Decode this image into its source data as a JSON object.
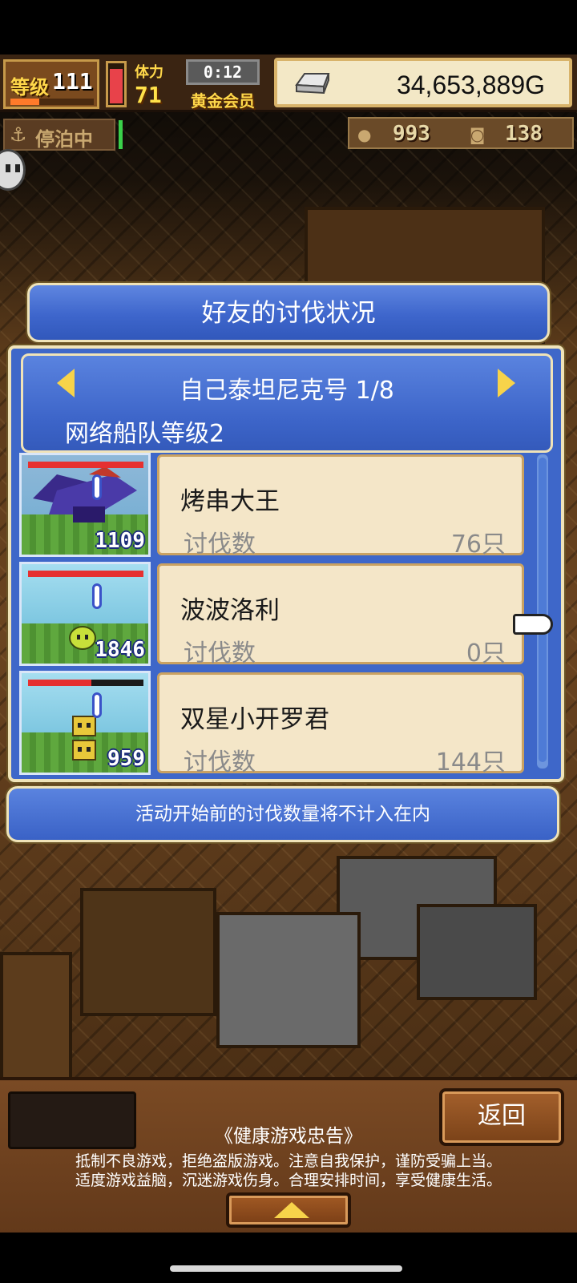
{
  "hud": {
    "level_label": "等级",
    "level": "111",
    "stamina_label": "体力",
    "stamina": "71",
    "timer": "0:12",
    "membership": "黄金会员",
    "gold": "34,653,889G",
    "mooring_status": "停泊中",
    "resource_1": "993",
    "resource_2": "138",
    "level_progress": 0.35,
    "stamina_fill": 0.9,
    "icons": {
      "gold": "silver-ingot-icon",
      "moor": "anchor-icon",
      "res1": "meat-icon",
      "res2": "coin-icon"
    }
  },
  "dialog": {
    "title": "好友的讨伐状况",
    "ship_name": "自己泰坦尼克号 1/8",
    "fleet_level": "网络船队等级2",
    "friends": [
      {
        "name": "烤串大王",
        "kill_label": "讨伐数",
        "kill_count": "76只",
        "thumb_count": "1109",
        "hp_fill": 1.0
      },
      {
        "name": "波波洛利",
        "kill_label": "讨伐数",
        "kill_count": "0只",
        "thumb_count": "1846",
        "hp_fill": 1.0
      },
      {
        "name": "双星小开罗君",
        "kill_label": "讨伐数",
        "kill_count": "144只",
        "thumb_count": "959",
        "hp_fill": 0.55
      }
    ],
    "notice": "活动开始前的讨伐数量将不计入在内"
  },
  "bottom": {
    "back_label": "返回",
    "advisory_title": "《健康游戏忠告》",
    "advisory_line1": "抵制不良游戏，拒绝盗版游戏。注意自我保护，谨防受骗上当。",
    "advisory_line2": "适度游戏益脑，沉迷游戏伤身。合理安排时间，享受健康生活。"
  },
  "colors": {
    "dialog_blue": "#3e67c9",
    "card_cream": "#f4e6c8",
    "accent_gold": "#f7d34a"
  }
}
